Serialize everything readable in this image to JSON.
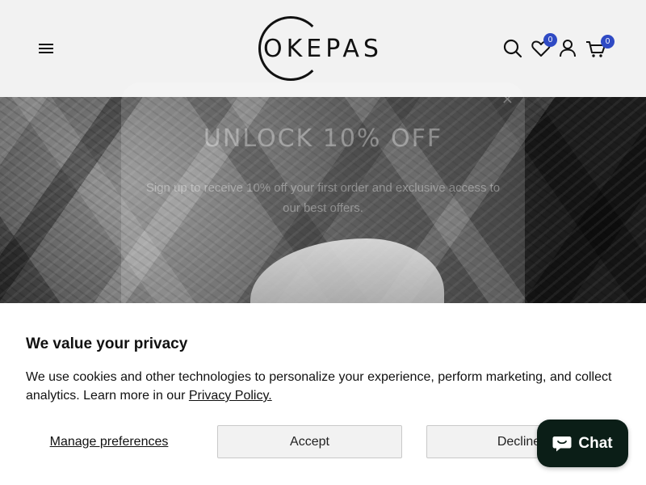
{
  "header": {
    "logo_text": "OKEPAS",
    "wishlist_count": "0",
    "cart_count": "0",
    "icons": [
      "menu-icon",
      "search-icon",
      "heart-icon",
      "user-icon",
      "cart-icon"
    ],
    "badge_color": "#2f4ac4"
  },
  "popup": {
    "close_glyph": "×",
    "title": "UNLOCK 10% OFF",
    "text": "Sign up to receive 10% off your first order and exclusive access to our best offers."
  },
  "privacy": {
    "title": "We value your privacy",
    "text": "We use cookies and other technologies to personalize your experience, perform marketing, and collect analytics. Learn more in our ",
    "link_label": "Privacy Policy.",
    "manage_label": "Manage preferences",
    "accept_label": "Accept",
    "decline_label": "Decline"
  },
  "chat": {
    "label": "Chat",
    "color": "#0b1e17"
  }
}
